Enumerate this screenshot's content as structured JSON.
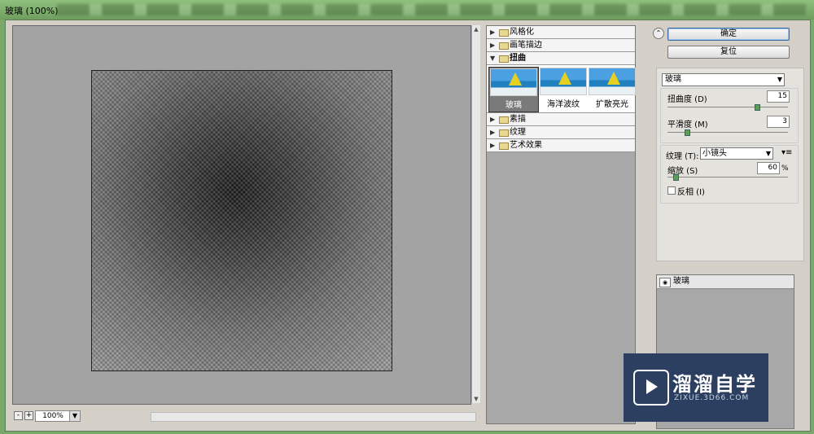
{
  "window": {
    "title": "玻璃 (100%)"
  },
  "preview": {
    "zoom": "100%",
    "zoom_out": "-",
    "zoom_in": "+"
  },
  "gallery": {
    "categories_before": [
      {
        "label": "风格化"
      },
      {
        "label": "画笔描边"
      }
    ],
    "open_category": {
      "label": "扭曲"
    },
    "thumbs": [
      {
        "label": "玻璃"
      },
      {
        "label": "海洋波纹"
      },
      {
        "label": "扩散亮光"
      }
    ],
    "categories_after": [
      {
        "label": "素描"
      },
      {
        "label": "纹理"
      },
      {
        "label": "艺术效果"
      }
    ]
  },
  "buttons": {
    "ok": "确定",
    "reset": "复位"
  },
  "settings": {
    "filter_select": "玻璃",
    "distortion_label": "扭曲度 (D)",
    "distortion_value": "15",
    "distortion_fraction": 0.75,
    "smoothness_label": "平滑度 (M)",
    "smoothness_value": "3",
    "smoothness_fraction": 0.15,
    "texture_label": "纹理 (T):",
    "texture_value": "小镜头",
    "scaling_label": "缩放 (S)",
    "scaling_value": "60",
    "scaling_unit": "%",
    "scaling_fraction": 0.05,
    "invert_label": "反相 (I)"
  },
  "layers": {
    "active": "玻璃"
  },
  "watermark": {
    "title": "溜溜自学",
    "url": "ZIXUE.3D66.COM"
  }
}
